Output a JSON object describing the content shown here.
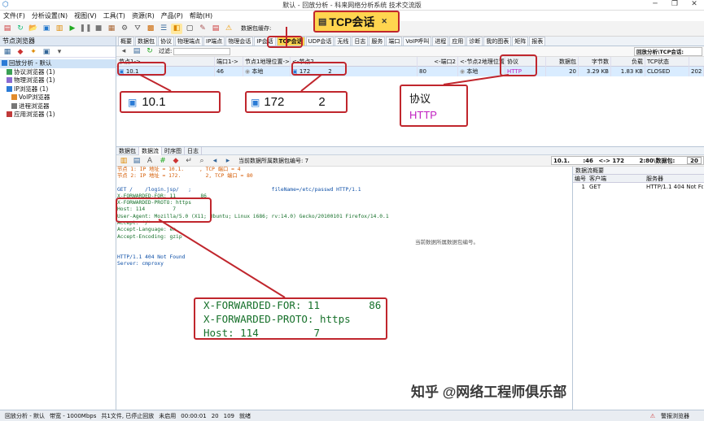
{
  "window": {
    "title": "默认 - 回放分析 - 科来网络分析系统 技术交流版"
  },
  "menu": [
    "文件(F)",
    "分析设置(N)",
    "视图(V)",
    "工具(T)",
    "资源(R)",
    "产品(P)",
    "帮助(H)"
  ],
  "toolbar": {
    "packet_cache_label": "数据包缓存:"
  },
  "sidebar": {
    "title": "节点浏览器",
    "items": [
      {
        "label": "回放分析 - 默认",
        "icon": "analysis-icon"
      },
      {
        "label": "协议浏览器 (1)",
        "icon": "protocol-icon"
      },
      {
        "label": "物理浏览器 (1)",
        "icon": "physical-icon"
      },
      {
        "label": "IP浏览器 (1)",
        "icon": "ip-icon"
      },
      {
        "label": "VoIP浏览器",
        "icon": "voip-icon"
      },
      {
        "label": "进程浏览器",
        "icon": "process-icon"
      },
      {
        "label": "应用浏览器 (1)",
        "icon": "app-icon"
      }
    ]
  },
  "tabs": [
    "概要",
    "数据包",
    "协议",
    "物理端点",
    "IP端点",
    "物理会话",
    "IP会话",
    "TCP会话",
    "UDP会话",
    "无线",
    "日志",
    "服务",
    "端口",
    "VoIP呼叫",
    "进程",
    "应用",
    "诊断",
    "我的图表",
    "矩阵",
    "报表"
  ],
  "zoom_tab": {
    "label": "TCP会话"
  },
  "filter": {
    "label": "过滤:",
    "title": "回放分析\\TCP会话:"
  },
  "grid": {
    "headers": [
      "节点1->",
      "端口1->",
      "节点1地理位置->",
      "<-节点2",
      "<-端口2",
      "<-节点2地理位置",
      "协议",
      "数据包",
      "字节数",
      "负载",
      "TCP状态"
    ],
    "row": [
      "10.1",
      "46",
      "本地",
      "172",
      "2",
      "80",
      "本地",
      "HTTP",
      "20",
      "3.29 KB",
      "1.83 KB",
      "CLOSED",
      "202"
    ]
  },
  "zoom": {
    "node1": "10.1",
    "node2": "172",
    "port2": "2",
    "proto_header": "协议",
    "proto_value": "HTTP"
  },
  "bottom_tabs": [
    "数据包",
    "数据流",
    "时序图",
    "日志"
  ],
  "flowbar": {
    "label": "当前数据所属数据包编号: 7",
    "addr": "10.1.",
    "port": ":46",
    "arrow": "<-> 172",
    "port2": "2:80\\数据包:",
    "count": "20"
  },
  "stream": {
    "header1": "节点 1: IP 地址 = 10.1.     , TCP 端口 = 4",
    "header2": "节点 2: IP 地址 = 172.        2, TCP 端口 = 80",
    "lines": [
      {
        "t": "GET /    /login.jsp/   ;                          fileName=/etc/passwd HTTP/1.1",
        "k": "cl"
      },
      {
        "t": "X-FORWARDED-FOR: 11        86",
        "k": "sv"
      },
      {
        "t": "X-FORWARDED-PROTO: https",
        "k": "sv"
      },
      {
        "t": "Host: 114         7",
        "k": "sv"
      },
      {
        "t": "User-Agent: Mozilla/5.0 (X11; Ubuntu; Linux i686; rv:14.0) Gecko/20100101 Firefox/14.0.1",
        "k": "sv"
      },
      {
        "t": "Accept: */*",
        "k": "sv"
      },
      {
        "t": "Accept-Language: en",
        "k": "sv"
      },
      {
        "t": "Accept-Encoding: gzip",
        "k": "sv"
      },
      {
        "t": "",
        "k": "sv"
      },
      {
        "t": "",
        "k": "sv"
      },
      {
        "t": "HTTP/1.1 404 Not Found",
        "k": "cl"
      },
      {
        "t": "Server: cmproxy",
        "k": "cl"
      }
    ],
    "tooltip": "当前数据所属数据包编号。"
  },
  "zoom_stream": {
    "line1": "X-FORWARDED-FOR: 11        86",
    "line2": "X-FORWARDED-PROTO: https",
    "line3": "Host: 114         7"
  },
  "flow_summary": {
    "title": "数据流概要",
    "headers": [
      "编号",
      "客户端",
      "服务器"
    ],
    "row": [
      "1",
      "GET",
      "HTTP/1.1 404 Not Fo"
    ]
  },
  "statusbar": [
    "回放分析 - 默认",
    "带宽 - 1000Mbps",
    "共1文件, 已停止回放",
    "未启用",
    "00:00:01",
    "20",
    "109",
    "就绪",
    "警报浏览器"
  ],
  "watermark": "知乎 @网络工程师俱乐部",
  "colors": {
    "accent": "#ffd54f",
    "callout": "#c0262d",
    "http": "#c020c0"
  }
}
